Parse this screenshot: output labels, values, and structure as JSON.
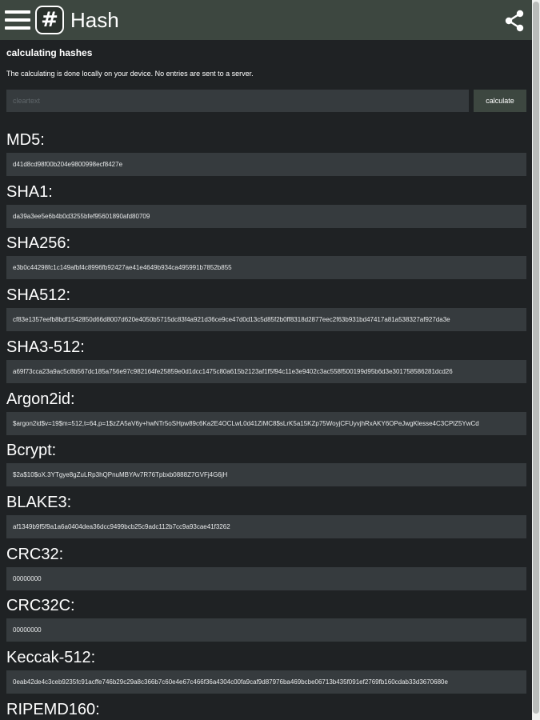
{
  "header": {
    "menu_icon": "hamburger-menu-icon",
    "logo_glyph": "#",
    "title": "Hash",
    "share_icon": "share-icon"
  },
  "form": {
    "section_title": "calculating hashes",
    "description": "The calculating is done locally on your device. No entries are sent to a server.",
    "input_placeholder": "cleartext",
    "input_value": "",
    "button_label": "calculate"
  },
  "hashes": [
    {
      "label": "MD5:",
      "value": "d41d8cd98f00b204e9800998ecf8427e"
    },
    {
      "label": "SHA1:",
      "value": "da39a3ee5e6b4b0d3255bfef95601890afd80709"
    },
    {
      "label": "SHA256:",
      "value": "e3b0c44298fc1c149afbf4c8996fb92427ae41e4649b934ca495991b7852b855"
    },
    {
      "label": "SHA512:",
      "value": "cf83e1357eefb8bdf1542850d66d8007d620e4050b5715dc83f4a921d36ce9ce47d0d13c5d85f2b0ff8318d2877eec2f63b931bd47417a81a538327af927da3e"
    },
    {
      "label": "SHA3-512:",
      "value": "a69f73cca23a9ac5c8b567dc185a756e97c982164fe25859e0d1dcc1475c80a615b2123af1f5f94c11e3e9402c3ac558f500199d95b6d3e301758586281dcd26"
    },
    {
      "label": "Argon2id:",
      "value": "$argon2id$v=19$m=512,t=64,p=1$zZA5aV6y+hwNTr5oSHpw89c6Ka2E4OCLwL0d41ZiMC8$sLrK5a15KZp75WoyjCFUyvjhRxAKY6OPeJwgKlesse4C3CPlZ5YwCd"
    },
    {
      "label": "Bcrypt:",
      "value": "$2a$10$oX.3YTgye8gZuLRp3hQPnuMBYAv7R76Tpbxb0888Z7GVFj4G6jH"
    },
    {
      "label": "BLAKE3:",
      "value": "af1349b9f5f9a1a6a0404dea36dcc9499bcb25c9adc112b7cc9a93cae41f3262"
    },
    {
      "label": "CRC32:",
      "value": "00000000"
    },
    {
      "label": "CRC32C:",
      "value": "00000000"
    },
    {
      "label": "Keccak-512:",
      "value": "0eab42de4c3ceb9235fc91acffe746b29c29a8c366b7c60e4e67c466f36a4304c00fa9caf9d87976ba469bcbe06713b435f091ef2769fb160cdab33d3670680e"
    },
    {
      "label": "RIPEMD160:",
      "value": ""
    }
  ]
}
